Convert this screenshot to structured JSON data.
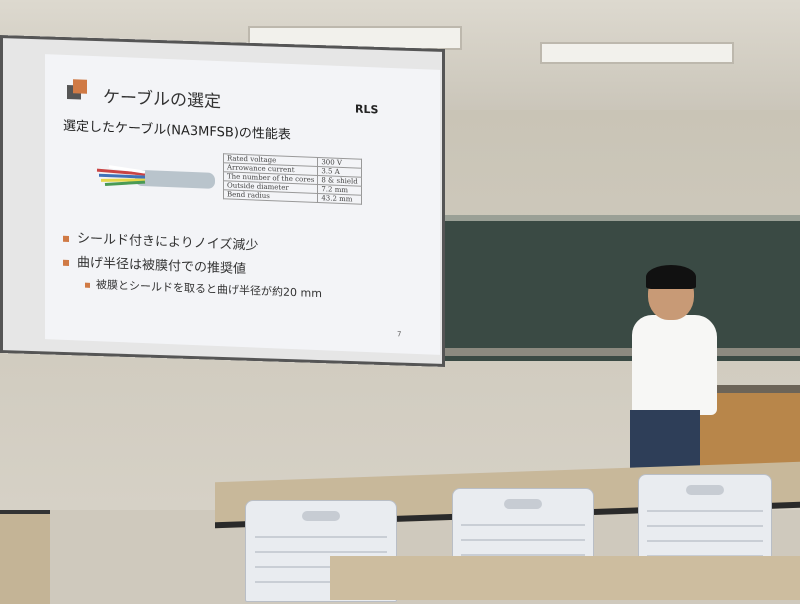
{
  "slide": {
    "title": "ケーブルの選定",
    "logo": "RLS",
    "subtitle": "選定したケーブル(NA3MFSB)の性能表",
    "spec_table": [
      {
        "label": "Rated voltage",
        "value": "300 V"
      },
      {
        "label": "Arrowance current",
        "value": "3.5 A"
      },
      {
        "label": "The number of the cores",
        "value": "8 & shield"
      },
      {
        "label": "Outside diameter",
        "value": "7.2 mm"
      },
      {
        "label": "Bend radius",
        "value": "43.2 mm"
      }
    ],
    "bullets": [
      "シールド付きによりノイズ減少",
      "曲げ半径は被膜付での推奨値"
    ],
    "sub_bullet": "被膜とシールドを取ると曲げ半径が約20 mm",
    "page_number": "7"
  },
  "colors": {
    "accent": "#d07a45",
    "chalkboard": "#3a4a44"
  }
}
